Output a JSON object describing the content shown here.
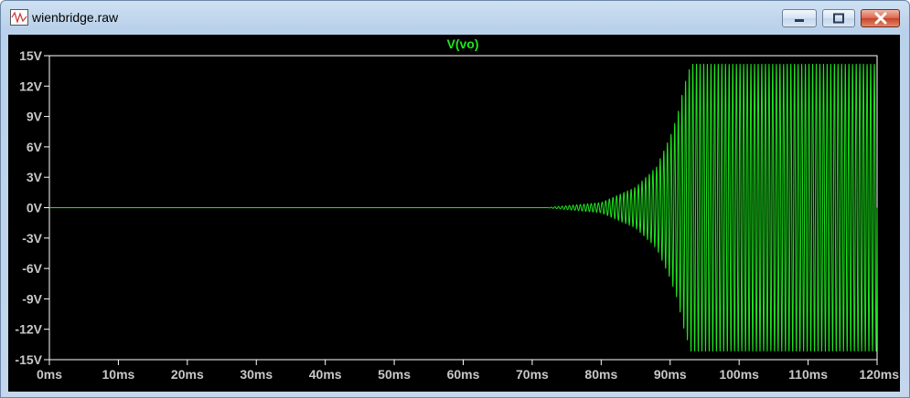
{
  "window": {
    "title": "wienbridge.raw",
    "controls": {
      "minimize": "minimize-icon",
      "maximize": "maximize-icon",
      "close": "close-icon"
    }
  },
  "colors": {
    "trace": "#1ee51e",
    "axis": "#ffffff",
    "tick_label": "#c8c8c8",
    "background": "#000000"
  },
  "chart_data": {
    "type": "line",
    "title": "V(vo)",
    "x_unit": "ms",
    "y_unit": "V",
    "xlim": [
      0,
      120
    ],
    "ylim": [
      -15,
      15
    ],
    "x_ticks": [
      "0ms",
      "10ms",
      "20ms",
      "30ms",
      "40ms",
      "50ms",
      "60ms",
      "70ms",
      "80ms",
      "90ms",
      "100ms",
      "110ms",
      "120ms"
    ],
    "y_ticks": [
      "15V",
      "12V",
      "9V",
      "6V",
      "3V",
      "0V",
      "-3V",
      "-6V",
      "-9V",
      "-12V",
      "-15V"
    ],
    "grid": false,
    "series": [
      {
        "name": "V(vo)",
        "description_points": [
          [
            0,
            0
          ],
          [
            72,
            0
          ],
          [
            80,
            0.5
          ],
          [
            85,
            2
          ],
          [
            88,
            4
          ],
          [
            90,
            7
          ],
          [
            91,
            9
          ],
          [
            92,
            12
          ],
          [
            93,
            14.2
          ],
          [
            120,
            14.2
          ]
        ],
        "oscillation_frequency_hz": 1900
      }
    ]
  }
}
